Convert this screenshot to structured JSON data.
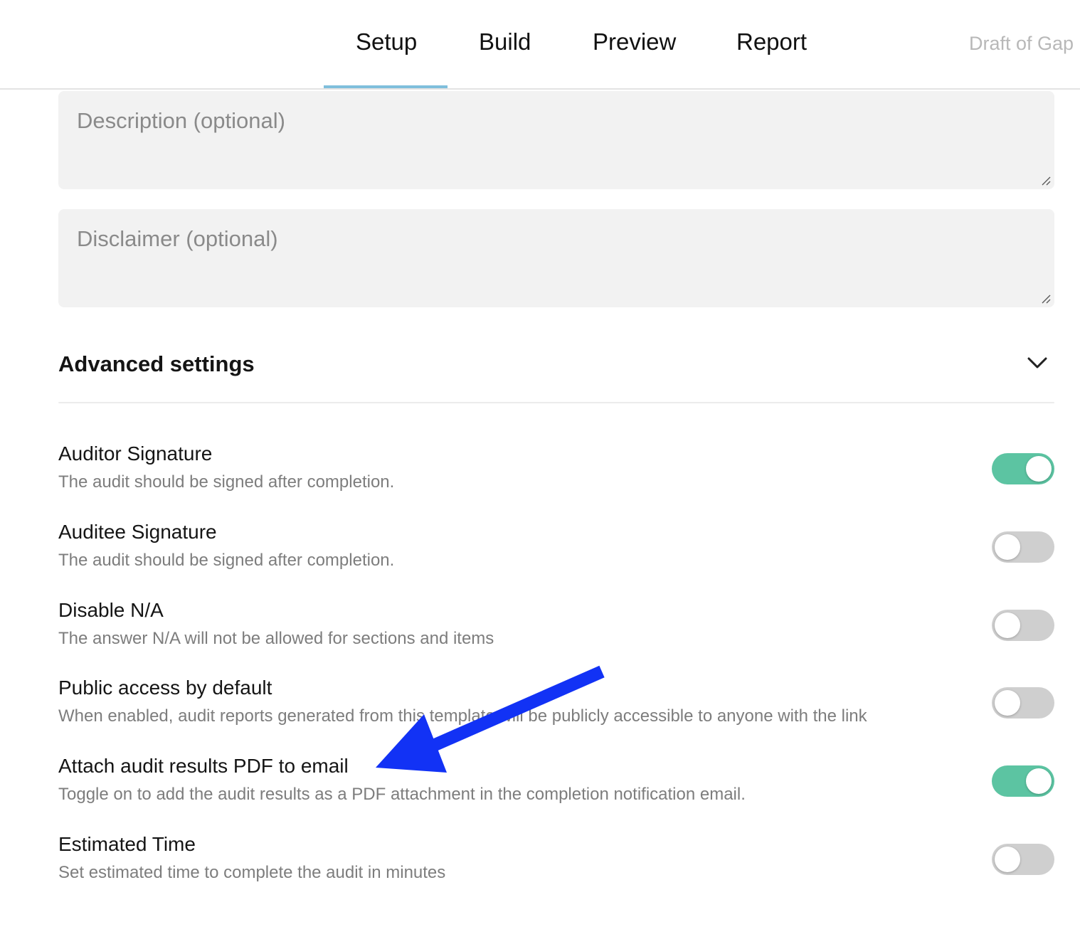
{
  "tabs": [
    {
      "label": "Setup",
      "active": true
    },
    {
      "label": "Build",
      "active": false
    },
    {
      "label": "Preview",
      "active": false
    },
    {
      "label": "Report",
      "active": false
    }
  ],
  "draft_label": "Draft of Gap",
  "description_placeholder": "Description (optional)",
  "disclaimer_placeholder": "Disclaimer (optional)",
  "advanced_title": "Advanced settings",
  "settings": [
    {
      "title": "Auditor Signature",
      "desc": "The audit should be signed after completion.",
      "enabled": true
    },
    {
      "title": "Auditee Signature",
      "desc": "The audit should be signed after completion.",
      "enabled": false
    },
    {
      "title": "Disable N/A",
      "desc": "The answer N/A will not be allowed for sections and items",
      "enabled": false
    },
    {
      "title": "Public access by default",
      "desc": "When enabled, audit reports generated from this template will be publicly accessible to anyone with the link",
      "enabled": false
    },
    {
      "title": "Attach audit results PDF to email",
      "desc": "Toggle on to add the audit results as a PDF attachment in the completion notification email.",
      "enabled": true
    },
    {
      "title": "Estimated Time",
      "desc": "Set estimated time to complete the audit in minutes",
      "enabled": false
    }
  ],
  "colors": {
    "toggle_on": "#5cc4a2",
    "toggle_off": "#cfcfcf",
    "tab_underline": "#7fbfdc",
    "annotation_arrow": "#1232f5"
  }
}
